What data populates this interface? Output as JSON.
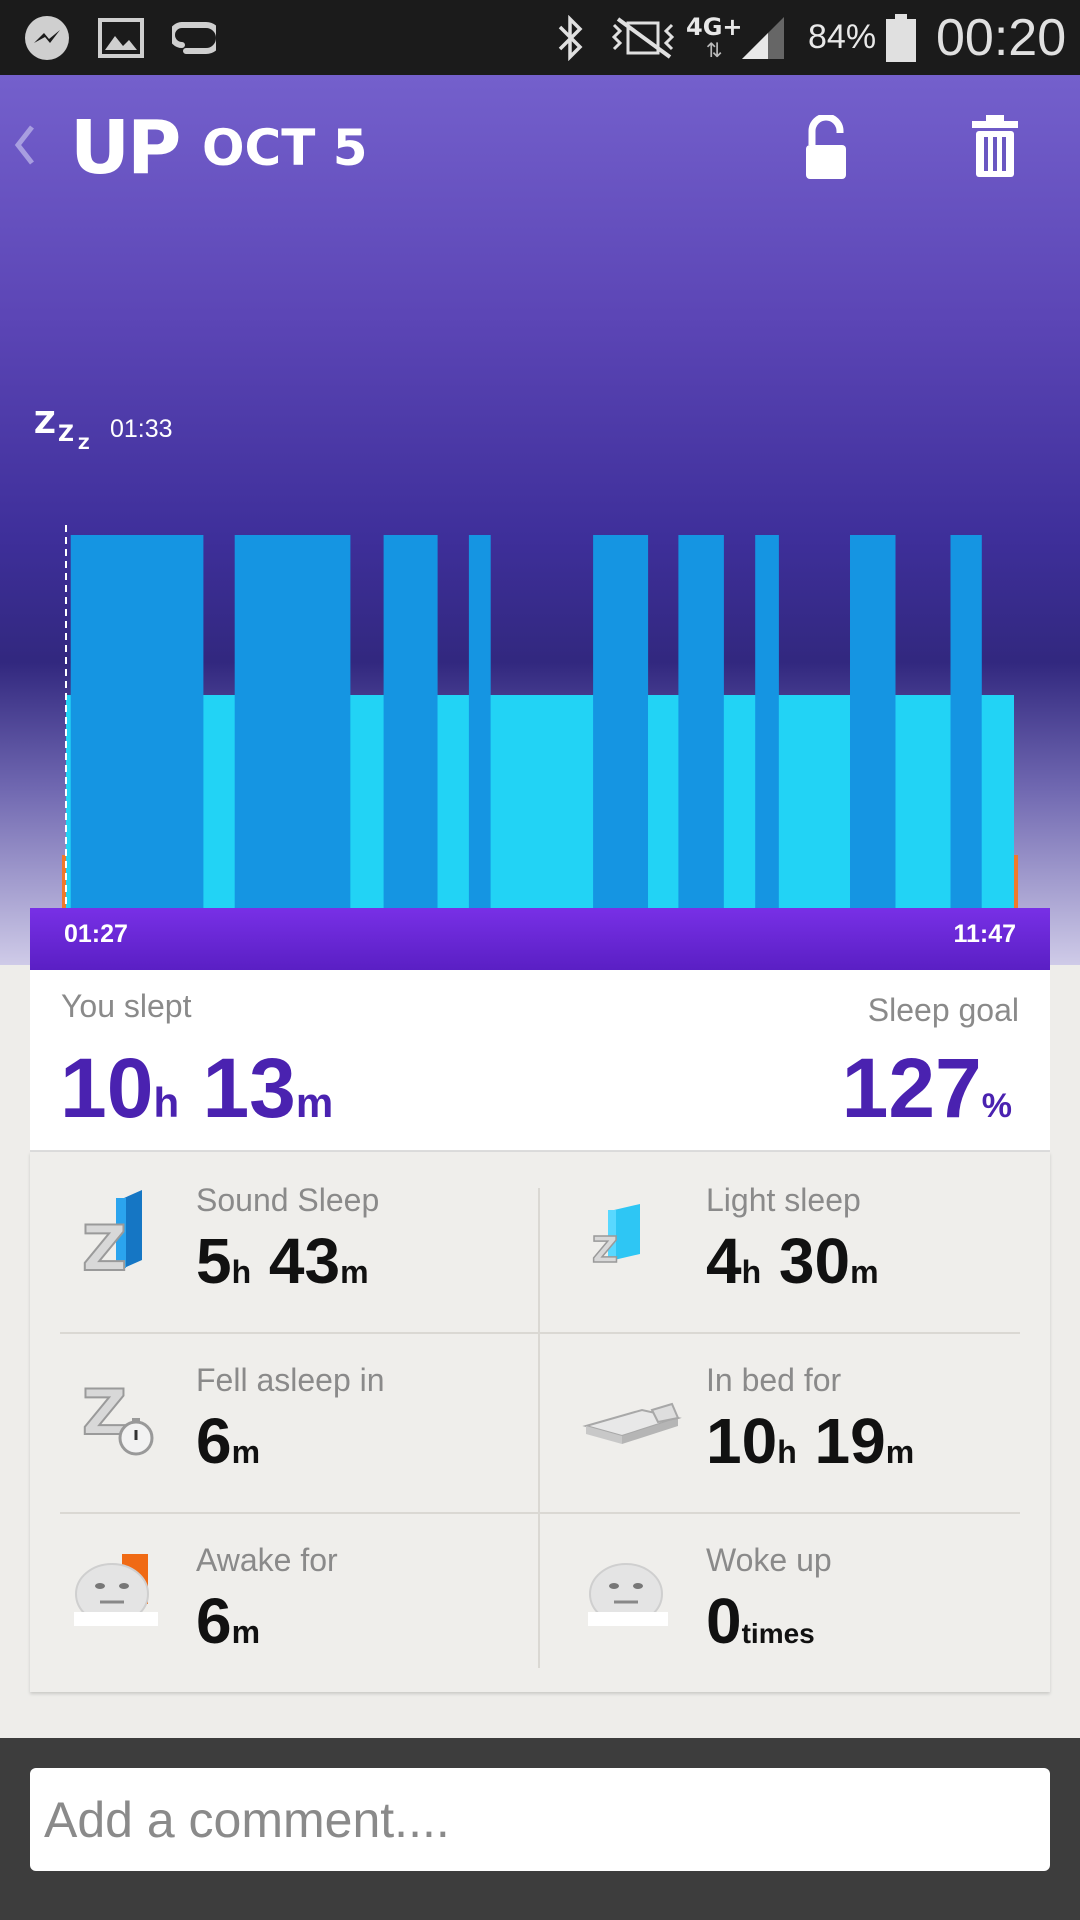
{
  "status_bar": {
    "battery": "84%",
    "time": "00:20",
    "network": "4G+",
    "icons": [
      "messenger-icon",
      "gallery-icon",
      "up-app-icon",
      "bluetooth-icon",
      "vibrate-icon",
      "signal-icon",
      "battery-icon"
    ]
  },
  "header": {
    "back_icon": "back-chevron-icon",
    "app_name": "UP",
    "date": "OCT 5",
    "lock_icon": "unlock-icon",
    "delete_icon": "trash-icon"
  },
  "chart_data": {
    "type": "bar",
    "start_label": "01:33",
    "time_range": [
      "01:27",
      "11:47"
    ],
    "levels": [
      "light",
      "sound"
    ],
    "segments": [
      {
        "level": "sound",
        "from": 0.005,
        "to": 0.145
      },
      {
        "level": "light",
        "from": 0.145,
        "to": 0.178
      },
      {
        "level": "sound",
        "from": 0.178,
        "to": 0.3
      },
      {
        "level": "light",
        "from": 0.3,
        "to": 0.335
      },
      {
        "level": "sound",
        "from": 0.335,
        "to": 0.392
      },
      {
        "level": "light",
        "from": 0.392,
        "to": 0.425
      },
      {
        "level": "sound",
        "from": 0.425,
        "to": 0.448
      },
      {
        "level": "light",
        "from": 0.448,
        "to": 0.556
      },
      {
        "level": "sound",
        "from": 0.556,
        "to": 0.614
      },
      {
        "level": "light",
        "from": 0.614,
        "to": 0.646
      },
      {
        "level": "sound",
        "from": 0.646,
        "to": 0.694
      },
      {
        "level": "light",
        "from": 0.694,
        "to": 0.727
      },
      {
        "level": "sound",
        "from": 0.727,
        "to": 0.752
      },
      {
        "level": "light",
        "from": 0.752,
        "to": 0.827
      },
      {
        "level": "sound",
        "from": 0.827,
        "to": 0.875
      },
      {
        "level": "light",
        "from": 0.875,
        "to": 0.933
      },
      {
        "level": "sound",
        "from": 0.933,
        "to": 0.966
      },
      {
        "level": "light",
        "from": 0.966,
        "to": 0.997
      }
    ],
    "colors": {
      "sound": "#1595e2",
      "light": "#22d3f5",
      "awake": "#f07a2a"
    }
  },
  "summary": {
    "slept_label": "You slept",
    "slept_hours": "10",
    "slept_minutes": "13",
    "goal_label": "Sleep goal",
    "goal_value": "127",
    "goal_unit": "%",
    "unit_h": "h",
    "unit_m": "m"
  },
  "stats": [
    {
      "label": "Sound Sleep",
      "hours": "5",
      "minutes": "43",
      "icon": "sound-sleep-icon"
    },
    {
      "label": "Light sleep",
      "hours": "4",
      "minutes": "30",
      "icon": "light-sleep-icon"
    },
    {
      "label": "Fell asleep in",
      "minutes": "6",
      "icon": "fell-asleep-icon"
    },
    {
      "label": "In bed for",
      "hours": "10",
      "minutes": "19",
      "icon": "bed-icon"
    },
    {
      "label": "Awake for",
      "minutes": "6",
      "icon": "awake-face-icon"
    },
    {
      "label": "Woke up",
      "count": "0",
      "count_unit": "times",
      "icon": "woke-up-face-icon"
    }
  ],
  "comment": {
    "placeholder": "Add a comment...."
  }
}
